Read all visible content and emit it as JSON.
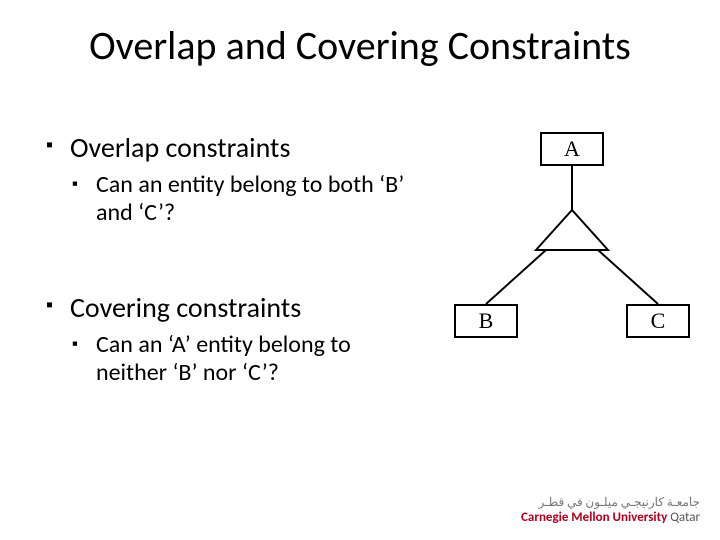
{
  "title": "Overlap and Covering Constraints",
  "bullets": {
    "overlap": {
      "heading": "Overlap constraints",
      "sub": "Can an entity belong to both ‘B’ and ‘C’?"
    },
    "covering": {
      "heading": "Covering constraints",
      "sub": "Can an ‘A’ entity belong to neither ‘B’ nor ‘C’?"
    }
  },
  "diagram": {
    "nodes": {
      "a": "A",
      "b": "B",
      "c": "C"
    }
  },
  "footer": {
    "arabic": "جامعـة كارنيجـي ميلـون في قطـر",
    "brand": "Carnegie Mellon University ",
    "campus": "Qatar"
  }
}
